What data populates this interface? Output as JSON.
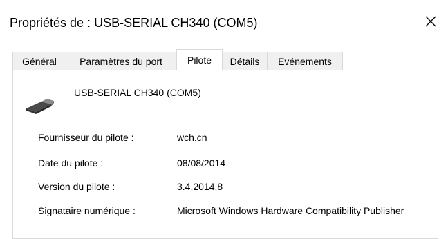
{
  "window": {
    "title": "Propriétés de : USB-SERIAL CH340 (COM5)",
    "close_glyph": "✕"
  },
  "tabs": [
    {
      "label": "Général",
      "active": false
    },
    {
      "label": "Paramètres du port",
      "active": false
    },
    {
      "label": "Pilote",
      "active": true
    },
    {
      "label": "Détails",
      "active": false
    },
    {
      "label": "Événements",
      "active": false
    }
  ],
  "device": {
    "icon": "usb-cable-icon",
    "name": "USB-SERIAL CH340 (COM5)"
  },
  "properties": [
    {
      "label": "Fournisseur du pilote :",
      "value": "wch.cn"
    },
    {
      "label": "Date du pilote :",
      "value": "08/08/2014"
    },
    {
      "label": "Version du pilote :",
      "value": "3.4.2014.8"
    },
    {
      "label": "Signataire numérique :",
      "value": "Microsoft Windows Hardware Compatibility Publisher"
    }
  ]
}
